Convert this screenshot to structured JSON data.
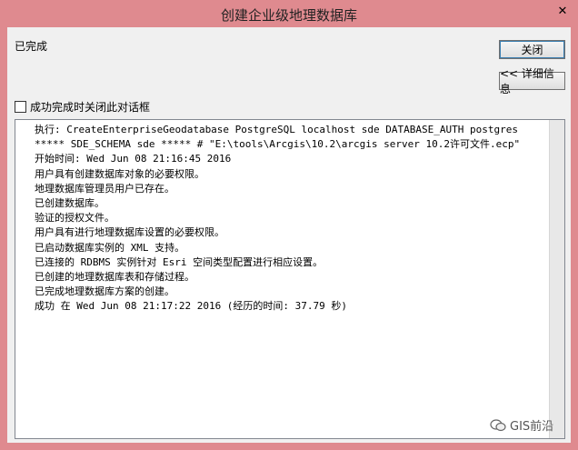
{
  "window": {
    "title": "创建企业级地理数据库"
  },
  "status": "已完成",
  "buttons": {
    "close": "关闭",
    "details": "<< 详细信息"
  },
  "checkbox_label": "成功完成时关闭此对话框",
  "log_lines": [
    "执行: CreateEnterpriseGeodatabase PostgreSQL localhost sde DATABASE_AUTH postgres",
    "***** SDE_SCHEMA sde ***** # \"E:\\tools\\Arcgis\\10.2\\arcgis server 10.2许可文件.ecp\"",
    "开始时间: Wed Jun 08 21:16:45 2016",
    "用户具有创建数据库对象的必要权限。",
    "地理数据库管理员用户已存在。",
    "已创建数据库。",
    "验证的授权文件。",
    "用户具有进行地理数据库设置的必要权限。",
    "已启动数据库实例的 XML 支持。",
    "已连接的 RDBMS 实例针对 Esri 空间类型配置进行相应设置。",
    "已创建的地理数据库表和存储过程。",
    "已完成地理数据库方案的创建。",
    "成功 在 Wed Jun 08 21:17:22 2016 (经历的时间: 37.79 秒)"
  ],
  "watermark": "GIS前沿"
}
